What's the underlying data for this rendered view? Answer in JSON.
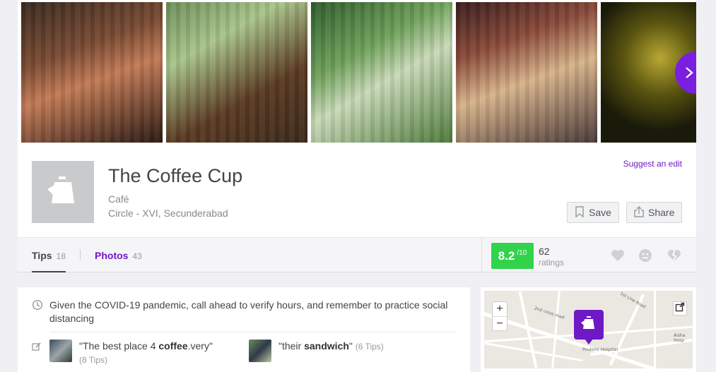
{
  "venue": {
    "name": "The Coffee Cup",
    "category": "Café",
    "address": "Circle - XVI, Secunderabad",
    "suggest_edit": "Suggest an edit",
    "save_label": "Save",
    "share_label": "Share"
  },
  "tabs": [
    {
      "label": "Tips",
      "count": "18"
    },
    {
      "label": "Photos",
      "count": "43"
    }
  ],
  "rating": {
    "score": "8.2",
    "out_of": "/10",
    "count": "62",
    "count_label": "ratings",
    "color": "#31d34a"
  },
  "notice": "Given the COVID-19 pandemic, call ahead to verify hours, and remember to practice social distancing",
  "tips": [
    {
      "pre": "\"The best place 4 ",
      "bold": "coffee",
      "post": ".very\"",
      "count": "(8 Tips)"
    },
    {
      "pre": "\"their ",
      "bold": "sandwich",
      "post": "\"",
      "count": "(6 Tips)"
    }
  ],
  "map": {
    "zoom_in": "+",
    "zoom_out": "−",
    "labels": [
      "Poulomi Hospital",
      "2nd cross road",
      "Aisha Hosp",
      "1st Line Road"
    ]
  },
  "colors": {
    "accent": "#6e19c5",
    "next_button": "#7a1ee0"
  },
  "icons": [
    "chevron-right-icon",
    "coffee-pot-icon",
    "bookmark-icon",
    "share-icon",
    "clock-icon",
    "edit-icon",
    "heart-icon",
    "meh-icon",
    "broken-heart-icon",
    "expand-icon"
  ]
}
